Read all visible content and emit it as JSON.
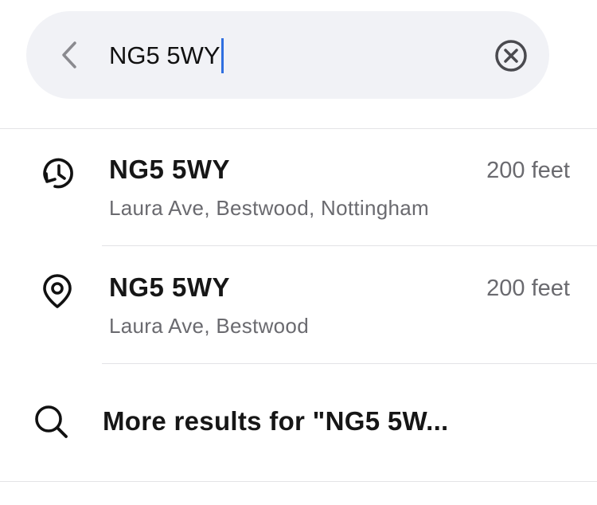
{
  "search": {
    "query": "NG5 5WY",
    "back_icon": "chevron-left-icon",
    "clear_icon": "clear-circle-icon",
    "caret_color": "#2f6fe0"
  },
  "results": [
    {
      "icon": "history-icon",
      "title": "NG5 5WY",
      "subtitle": "Laura Ave, Bestwood, Nottingham",
      "distance": "200 feet"
    },
    {
      "icon": "location-pin-icon",
      "title": "NG5 5WY",
      "subtitle": "Laura Ave, Bestwood",
      "distance": "200 feet"
    }
  ],
  "more_results": {
    "icon": "search-icon",
    "label": "More results for \"NG5 5W..."
  }
}
